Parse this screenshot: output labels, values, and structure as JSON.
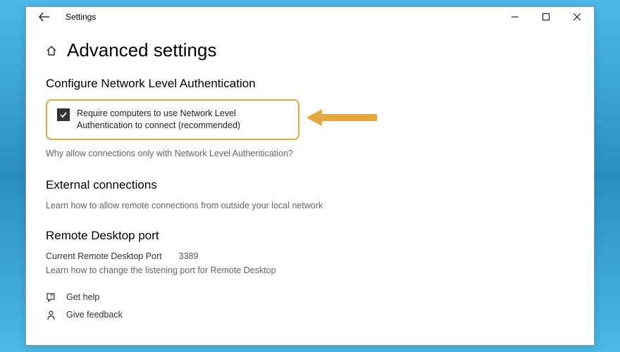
{
  "titlebar": {
    "title": "Settings"
  },
  "page": {
    "title": "Advanced settings"
  },
  "nla": {
    "section_title": "Configure Network Level Authentication",
    "checkbox_label": "Require computers to use Network Level Authentication to connect (recommended)",
    "link": "Why allow connections only with Network Level Authentication?",
    "checked": true
  },
  "external": {
    "title": "External connections",
    "text": "Learn how to allow remote connections from outside your local network"
  },
  "port": {
    "title": "Remote Desktop port",
    "label": "Current Remote Desktop Port",
    "value": "3389",
    "text": "Learn how to change the listening port for Remote Desktop"
  },
  "footer": {
    "get_help": "Get help",
    "give_feedback": "Give feedback"
  },
  "colors": {
    "highlight": "#e5a73e"
  }
}
